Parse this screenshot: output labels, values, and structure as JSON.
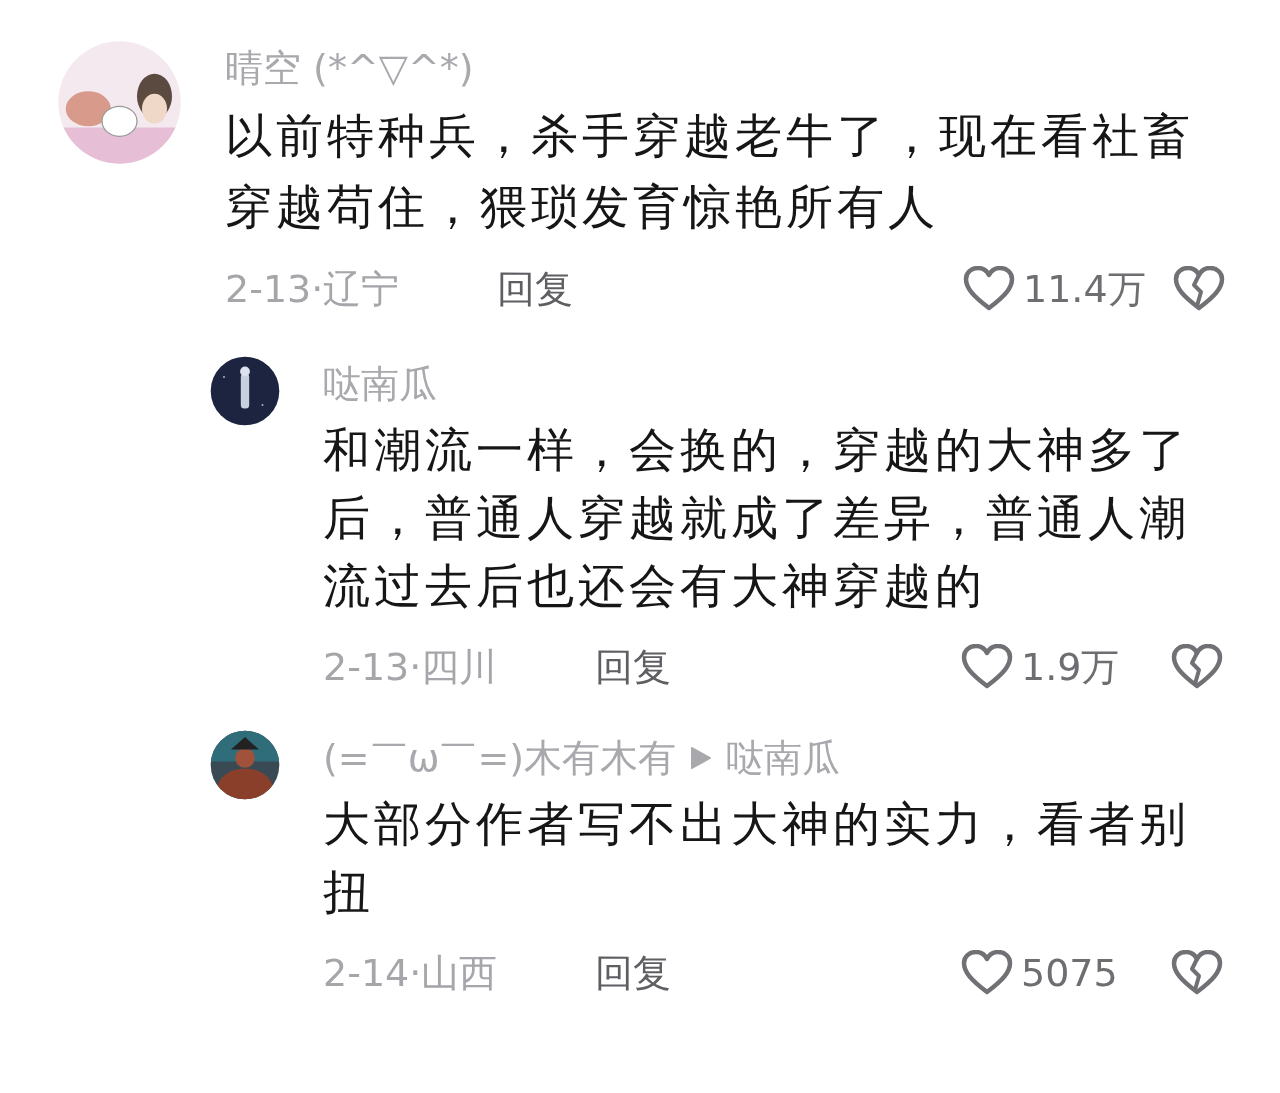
{
  "comments": [
    {
      "name": "晴空 (*^▽^*)",
      "body": "以前特种兵，杀手穿越老牛了，现在看社畜穿越苟住，猥琐发育惊艳所有人",
      "meta": "2-13·辽宁",
      "reply_label": "回复",
      "likes": "11.4万",
      "replies": [
        {
          "name": "哒南瓜",
          "body": "和潮流一样，会换的，穿越的大神多了后，普通人穿越就成了差异，普通人潮流过去后也还会有大神穿越的",
          "meta": "2-13·四川",
          "reply_label": "回复",
          "likes": "1.9万"
        },
        {
          "name": "(=￣ω￣=)木有木有",
          "reply_to": "哒南瓜",
          "body": "大部分作者写不出大神的实力，看者别扭",
          "meta": "2-14·山西",
          "reply_label": "回复",
          "likes": "5075"
        }
      ]
    }
  ]
}
